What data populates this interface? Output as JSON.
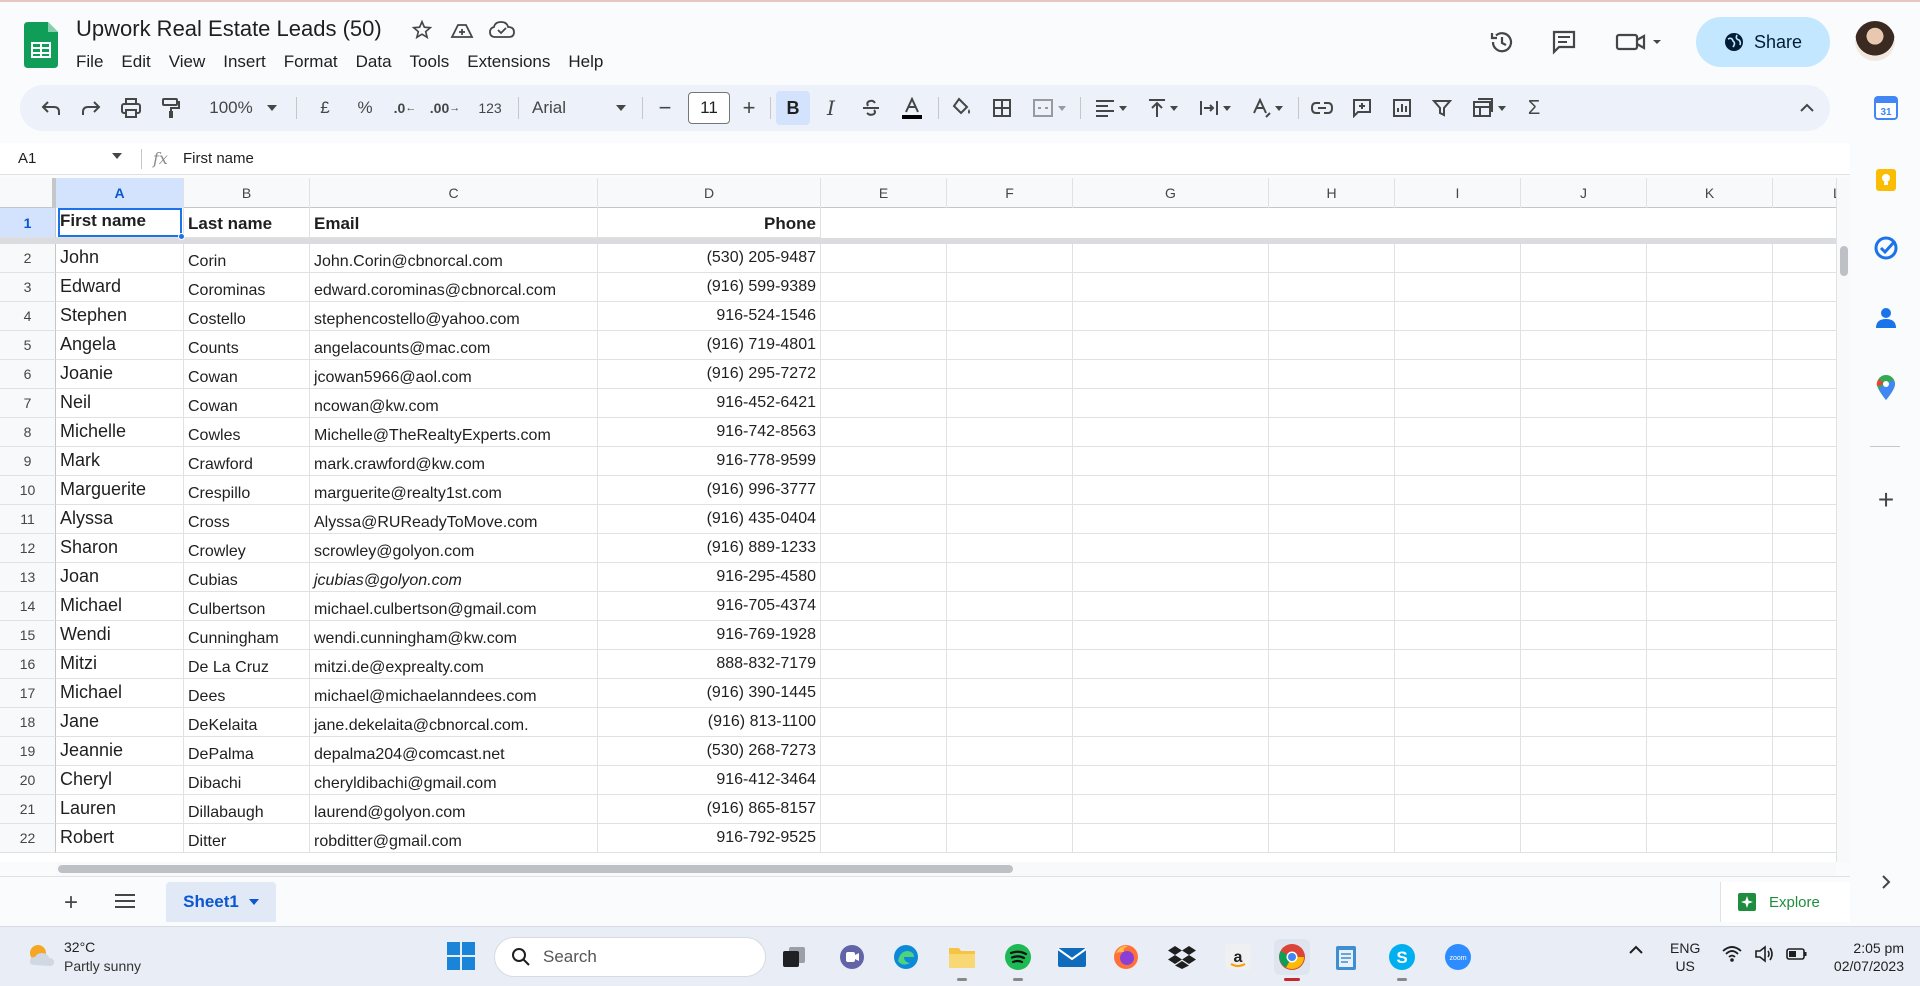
{
  "doc": {
    "title": "Upwork Real Estate Leads (50)",
    "menus": [
      "File",
      "Edit",
      "View",
      "Insert",
      "Format",
      "Data",
      "Tools",
      "Extensions",
      "Help"
    ],
    "share_label": "Share"
  },
  "toolbar": {
    "zoom": "100%",
    "currency": "£",
    "percent": "%",
    "dec_decrease": ".0",
    "dec_increase": ".00",
    "number_format": "123",
    "font": "Arial",
    "font_size": "11",
    "bold": "B",
    "italic": "I",
    "sigma": "Σ"
  },
  "formula_bar": {
    "cell_ref": "A1",
    "fx": "fx",
    "value": "First name"
  },
  "columns": [
    "A",
    "B",
    "C",
    "D",
    "E",
    "F",
    "G",
    "H",
    "I",
    "J",
    "K",
    "L"
  ],
  "header_row": {
    "first": "First name",
    "last": "Last name",
    "email": "Email",
    "phone": "Phone"
  },
  "rows": [
    {
      "n": "2",
      "first": "John",
      "last": "Corin",
      "email": "John.Corin@cbnorcal.com",
      "phone": "(530) 205-9487"
    },
    {
      "n": "3",
      "first": "Edward",
      "last": "Corominas",
      "email": "edward.corominas@cbnorcal.com",
      "phone": "(916) 599-9389"
    },
    {
      "n": "4",
      "first": "Stephen",
      "last": "Costello",
      "email": "stephencostello@yahoo.com",
      "phone": "916-524-1546"
    },
    {
      "n": "5",
      "first": "Angela",
      "last": "Counts",
      "email": "angelacounts@mac.com",
      "phone": "(916) 719-4801"
    },
    {
      "n": "6",
      "first": "Joanie",
      "last": "Cowan",
      "email": "jcowan5966@aol.com",
      "phone": "(916) 295-7272"
    },
    {
      "n": "7",
      "first": "Neil",
      "last": "Cowan",
      "email": "ncowan@kw.com",
      "phone": "916-452-6421"
    },
    {
      "n": "8",
      "first": "Michelle",
      "last": "Cowles",
      "email": "Michelle@TheRealtyExperts.com",
      "phone": "916-742-8563"
    },
    {
      "n": "9",
      "first": "Mark",
      "last": "Crawford",
      "email": "mark.crawford@kw.com",
      "phone": "916-778-9599"
    },
    {
      "n": "10",
      "first": "Marguerite",
      "last": "Crespillo",
      "email": "marguerite@realty1st.com",
      "phone": "(916) 996-3777"
    },
    {
      "n": "11",
      "first": "Alyssa",
      "last": "Cross",
      "email": "Alyssa@RUReadyToMove.com",
      "phone": "(916) 435-0404"
    },
    {
      "n": "12",
      "first": "Sharon",
      "last": "Crowley",
      "email": "scrowley@golyon.com",
      "phone": "(916) 889-1233"
    },
    {
      "n": "13",
      "first": "Joan",
      "last": "Cubias",
      "email": "jcubias@golyon.com",
      "phone": "916-295-4580"
    },
    {
      "n": "14",
      "first": "Michael",
      "last": "Culbertson",
      "email": "michael.culbertson@gmail.com",
      "phone": "916-705-4374"
    },
    {
      "n": "15",
      "first": "Wendi",
      "last": "Cunningham",
      "email": "wendi.cunningham@kw.com",
      "phone": "916-769-1928"
    },
    {
      "n": "16",
      "first": "Mitzi",
      "last": "De La Cruz",
      "email": "mitzi.de@exprealty.com",
      "phone": "888-832-7179"
    },
    {
      "n": "17",
      "first": "Michael",
      "last": "Dees",
      "email": "michael@michaelanndees.com",
      "phone": "(916) 390-1445"
    },
    {
      "n": "18",
      "first": "Jane",
      "last": "DeKelaita",
      "email": "jane.dekelaita@cbnorcal.com.",
      "phone": "(916) 813-1100"
    },
    {
      "n": "19",
      "first": "Jeannie",
      "last": "DePalma",
      "email": "depalma204@comcast.net",
      "phone": "(530) 268-7273"
    },
    {
      "n": "20",
      "first": "Cheryl",
      "last": "Dibachi",
      "email": "cheryldibachi@gmail.com",
      "phone": "916-412-3464"
    },
    {
      "n": "21",
      "first": "Lauren",
      "last": "Dillabaugh",
      "email": "laurend@golyon.com",
      "phone": "(916) 865-8157"
    },
    {
      "n": "22",
      "first": "Robert",
      "last": "Ditter",
      "email": "robditter@gmail.com",
      "phone": "916-792-9525"
    }
  ],
  "sheet_tab": "Sheet1",
  "explore_label": "Explore",
  "taskbar": {
    "temp": "32°C",
    "condition": "Partly sunny",
    "search": "Search",
    "lang": "ENG",
    "region": "US",
    "time": "2:05 pm",
    "date": "02/07/2023"
  },
  "colors": {
    "accent": "#1a73e8",
    "share_bg": "#c2e7ff",
    "sheets_green": "#0f9d58"
  }
}
